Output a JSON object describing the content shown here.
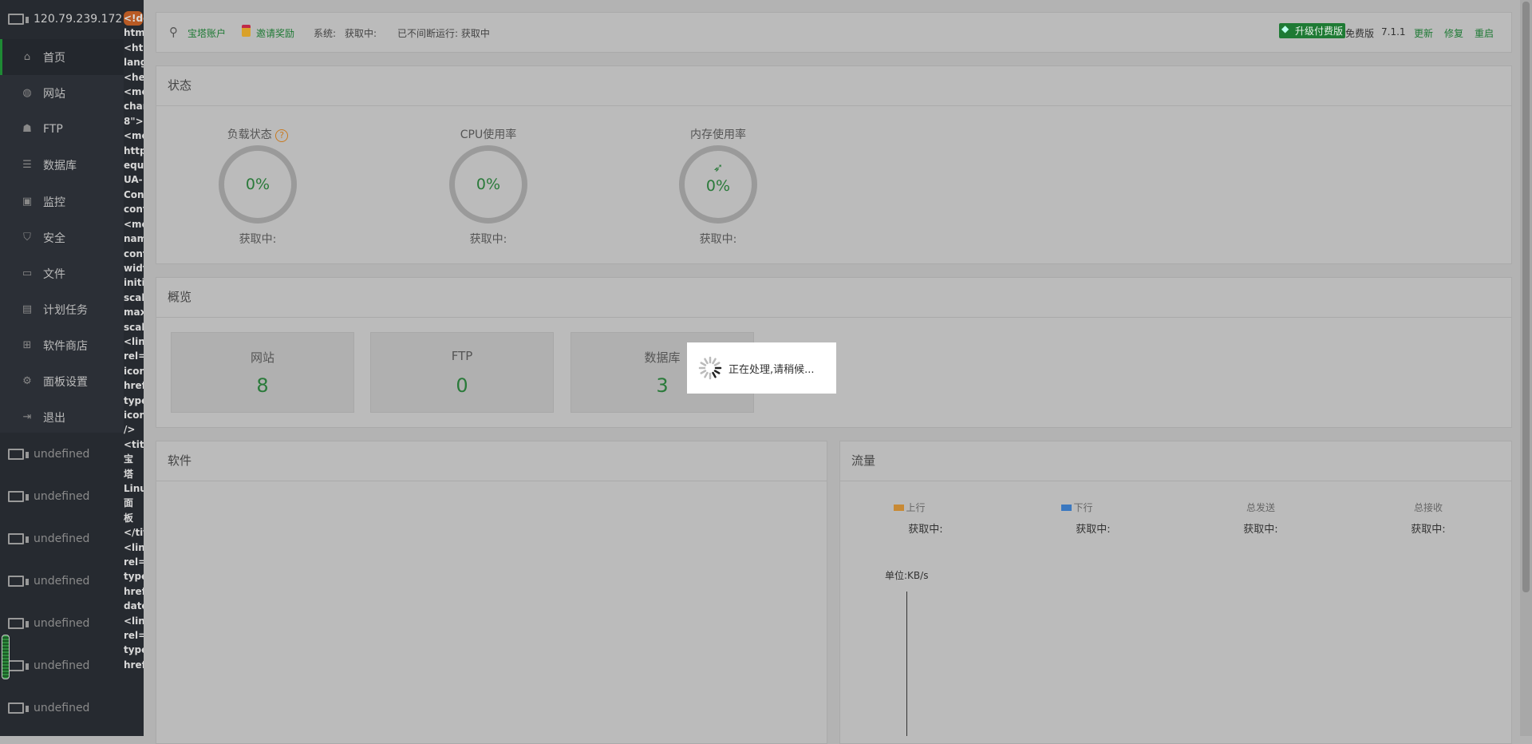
{
  "sidebar": {
    "host": "120.79.239.172",
    "items": [
      {
        "label": "首页",
        "icon": "home-icon"
      },
      {
        "label": "网站",
        "icon": "globe-icon"
      },
      {
        "label": "FTP",
        "icon": "ftp-icon"
      },
      {
        "label": "数据库",
        "icon": "database-icon"
      },
      {
        "label": "监控",
        "icon": "monitor-icon"
      },
      {
        "label": "安全",
        "icon": "shield-icon"
      },
      {
        "label": "文件",
        "icon": "folder-icon"
      },
      {
        "label": "计划任务",
        "icon": "calendar-icon"
      },
      {
        "label": "软件商店",
        "icon": "grid-icon"
      },
      {
        "label": "面板设置",
        "icon": "gear-icon"
      },
      {
        "label": "退出",
        "icon": "logout-icon"
      }
    ],
    "servers": [
      "undefined",
      "undefined",
      "undefined",
      "undefined",
      "undefined",
      "undefined",
      "undefined"
    ]
  },
  "code_strip": [
    "<!do",
    "htm",
    "<htm",
    "lang",
    "<hea",
    "<me",
    "char",
    "8\">",
    "<me",
    "http",
    "equ",
    "UA-",
    "Con",
    "cont",
    "<me",
    "nam",
    "cont",
    "widt",
    "initi",
    "scal",
    "max",
    "scal",
    "<linl",
    "rel=",
    "icon",
    "href",
    "type",
    "icon",
    " />",
    "<titl",
    " 宝",
    " 塔",
    "Linu",
    " 面",
    " 板",
    "</tit",
    "<linl",
    "rel=",
    "type",
    "href",
    "date",
    "<linl",
    "rel=",
    "type",
    "href"
  ],
  "header": {
    "account": "宝塔账户",
    "invite": "邀请奖励",
    "system_label": "系统:",
    "system_value": "获取中:",
    "uptime": "已不间断运行: 获取中",
    "upgrade": "升级付费版",
    "edition": "免费版",
    "version": "7.1.1",
    "update": "更新",
    "repair": "修复",
    "restart": "重启"
  },
  "status": {
    "title": "状态",
    "gauges": [
      {
        "label": "负载状态",
        "value": "0%",
        "sub": "获取中:"
      },
      {
        "label": "CPU使用率",
        "value": "0%",
        "sub": "获取中:"
      },
      {
        "label": "内存使用率",
        "value": "0%",
        "sub": "获取中:"
      }
    ]
  },
  "overview": {
    "title": "概览",
    "items": [
      {
        "label": "网站",
        "value": "8"
      },
      {
        "label": "FTP",
        "value": "0"
      },
      {
        "label": "数据库",
        "value": "3"
      }
    ]
  },
  "software": {
    "title": "软件"
  },
  "traffic": {
    "title": "流量",
    "items": [
      {
        "label": "上行",
        "value": "获取中:"
      },
      {
        "label": "下行",
        "value": "获取中:"
      },
      {
        "label": "总发送",
        "value": "获取中:"
      },
      {
        "label": "总接收",
        "value": "获取中:"
      }
    ],
    "unit": "单位:KB/s",
    "colors": {
      "up": "#c88a35",
      "down": "#3a78c0"
    }
  },
  "loading": {
    "text": "正在处理,请稍候..."
  }
}
